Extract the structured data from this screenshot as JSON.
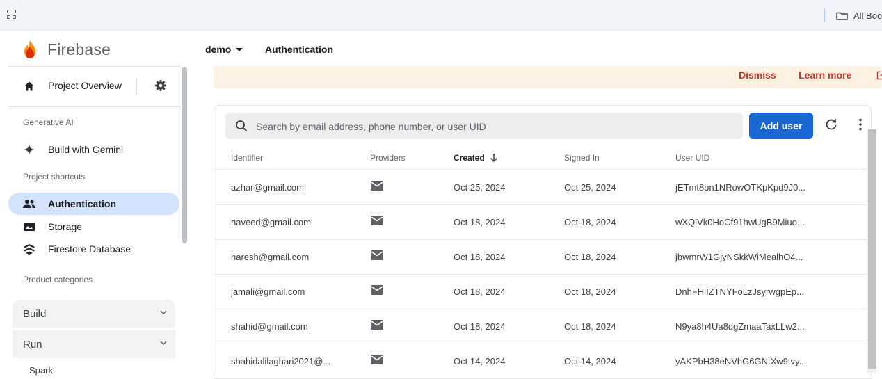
{
  "bookmarks_bar": {
    "all_bookmarks_label": "All Boo"
  },
  "brand": {
    "name": "Firebase"
  },
  "sidebar": {
    "project_overview": "Project Overview",
    "section_generative_ai": "Generative AI",
    "build_with_gemini": "Build with Gemini",
    "section_project_shortcuts": "Project shortcuts",
    "shortcuts": [
      {
        "label": "Authentication",
        "icon": "people-icon",
        "active": true
      },
      {
        "label": "Storage",
        "icon": "photo-icon",
        "active": false
      },
      {
        "label": "Firestore Database",
        "icon": "firestore-icon",
        "active": false
      }
    ],
    "section_product_categories": "Product categories",
    "categories": [
      {
        "label": "Build"
      },
      {
        "label": "Run"
      }
    ],
    "plan": "Spark"
  },
  "topbar": {
    "project": "demo",
    "breadcrumb": "Authentication"
  },
  "banner": {
    "dismiss": "Dismiss",
    "learn_more": "Learn more"
  },
  "users": {
    "search_placeholder": "Search by email address, phone number, or user UID",
    "add_user_label": "Add user",
    "columns": [
      "Identifier",
      "Providers",
      "Created",
      "Signed In",
      "User UID"
    ],
    "sorted_column": "Created",
    "rows": [
      {
        "identifier": "azhar@gmail.com",
        "provider": "email",
        "created": "Oct 25, 2024",
        "signed_in": "Oct 25, 2024",
        "uid": "jETmt8bn1NRowOTKpKpd9J0..."
      },
      {
        "identifier": "naveed@gmail.com",
        "provider": "email",
        "created": "Oct 18, 2024",
        "signed_in": "Oct 18, 2024",
        "uid": "wXQiVk0HoCf91hwUgB9Miuo..."
      },
      {
        "identifier": "haresh@gmail.com",
        "provider": "email",
        "created": "Oct 18, 2024",
        "signed_in": "Oct 18, 2024",
        "uid": "jbwmrW1GjyNSkkWiMealhO4..."
      },
      {
        "identifier": "jamali@gmail.com",
        "provider": "email",
        "created": "Oct 18, 2024",
        "signed_in": "Oct 18, 2024",
        "uid": "DnhFHlIZTNYFoLzJsyrwgpEp..."
      },
      {
        "identifier": "shahid@gmail.com",
        "provider": "email",
        "created": "Oct 18, 2024",
        "signed_in": "Oct 18, 2024",
        "uid": "N9ya8h4Ua8dgZmaaTaxLLw2..."
      },
      {
        "identifier": "shahidalilaghari2021@...",
        "provider": "email",
        "created": "Oct 14, 2024",
        "signed_in": "Oct 14, 2024",
        "uid": "yAKPbH38eNVhG6GNtXw9tvy..."
      }
    ]
  },
  "colors": {
    "primary": "#1967d2",
    "active_nav": "#d3e3fd",
    "banner_bg": "#fdf1e1",
    "banner_link": "#c0392b"
  }
}
